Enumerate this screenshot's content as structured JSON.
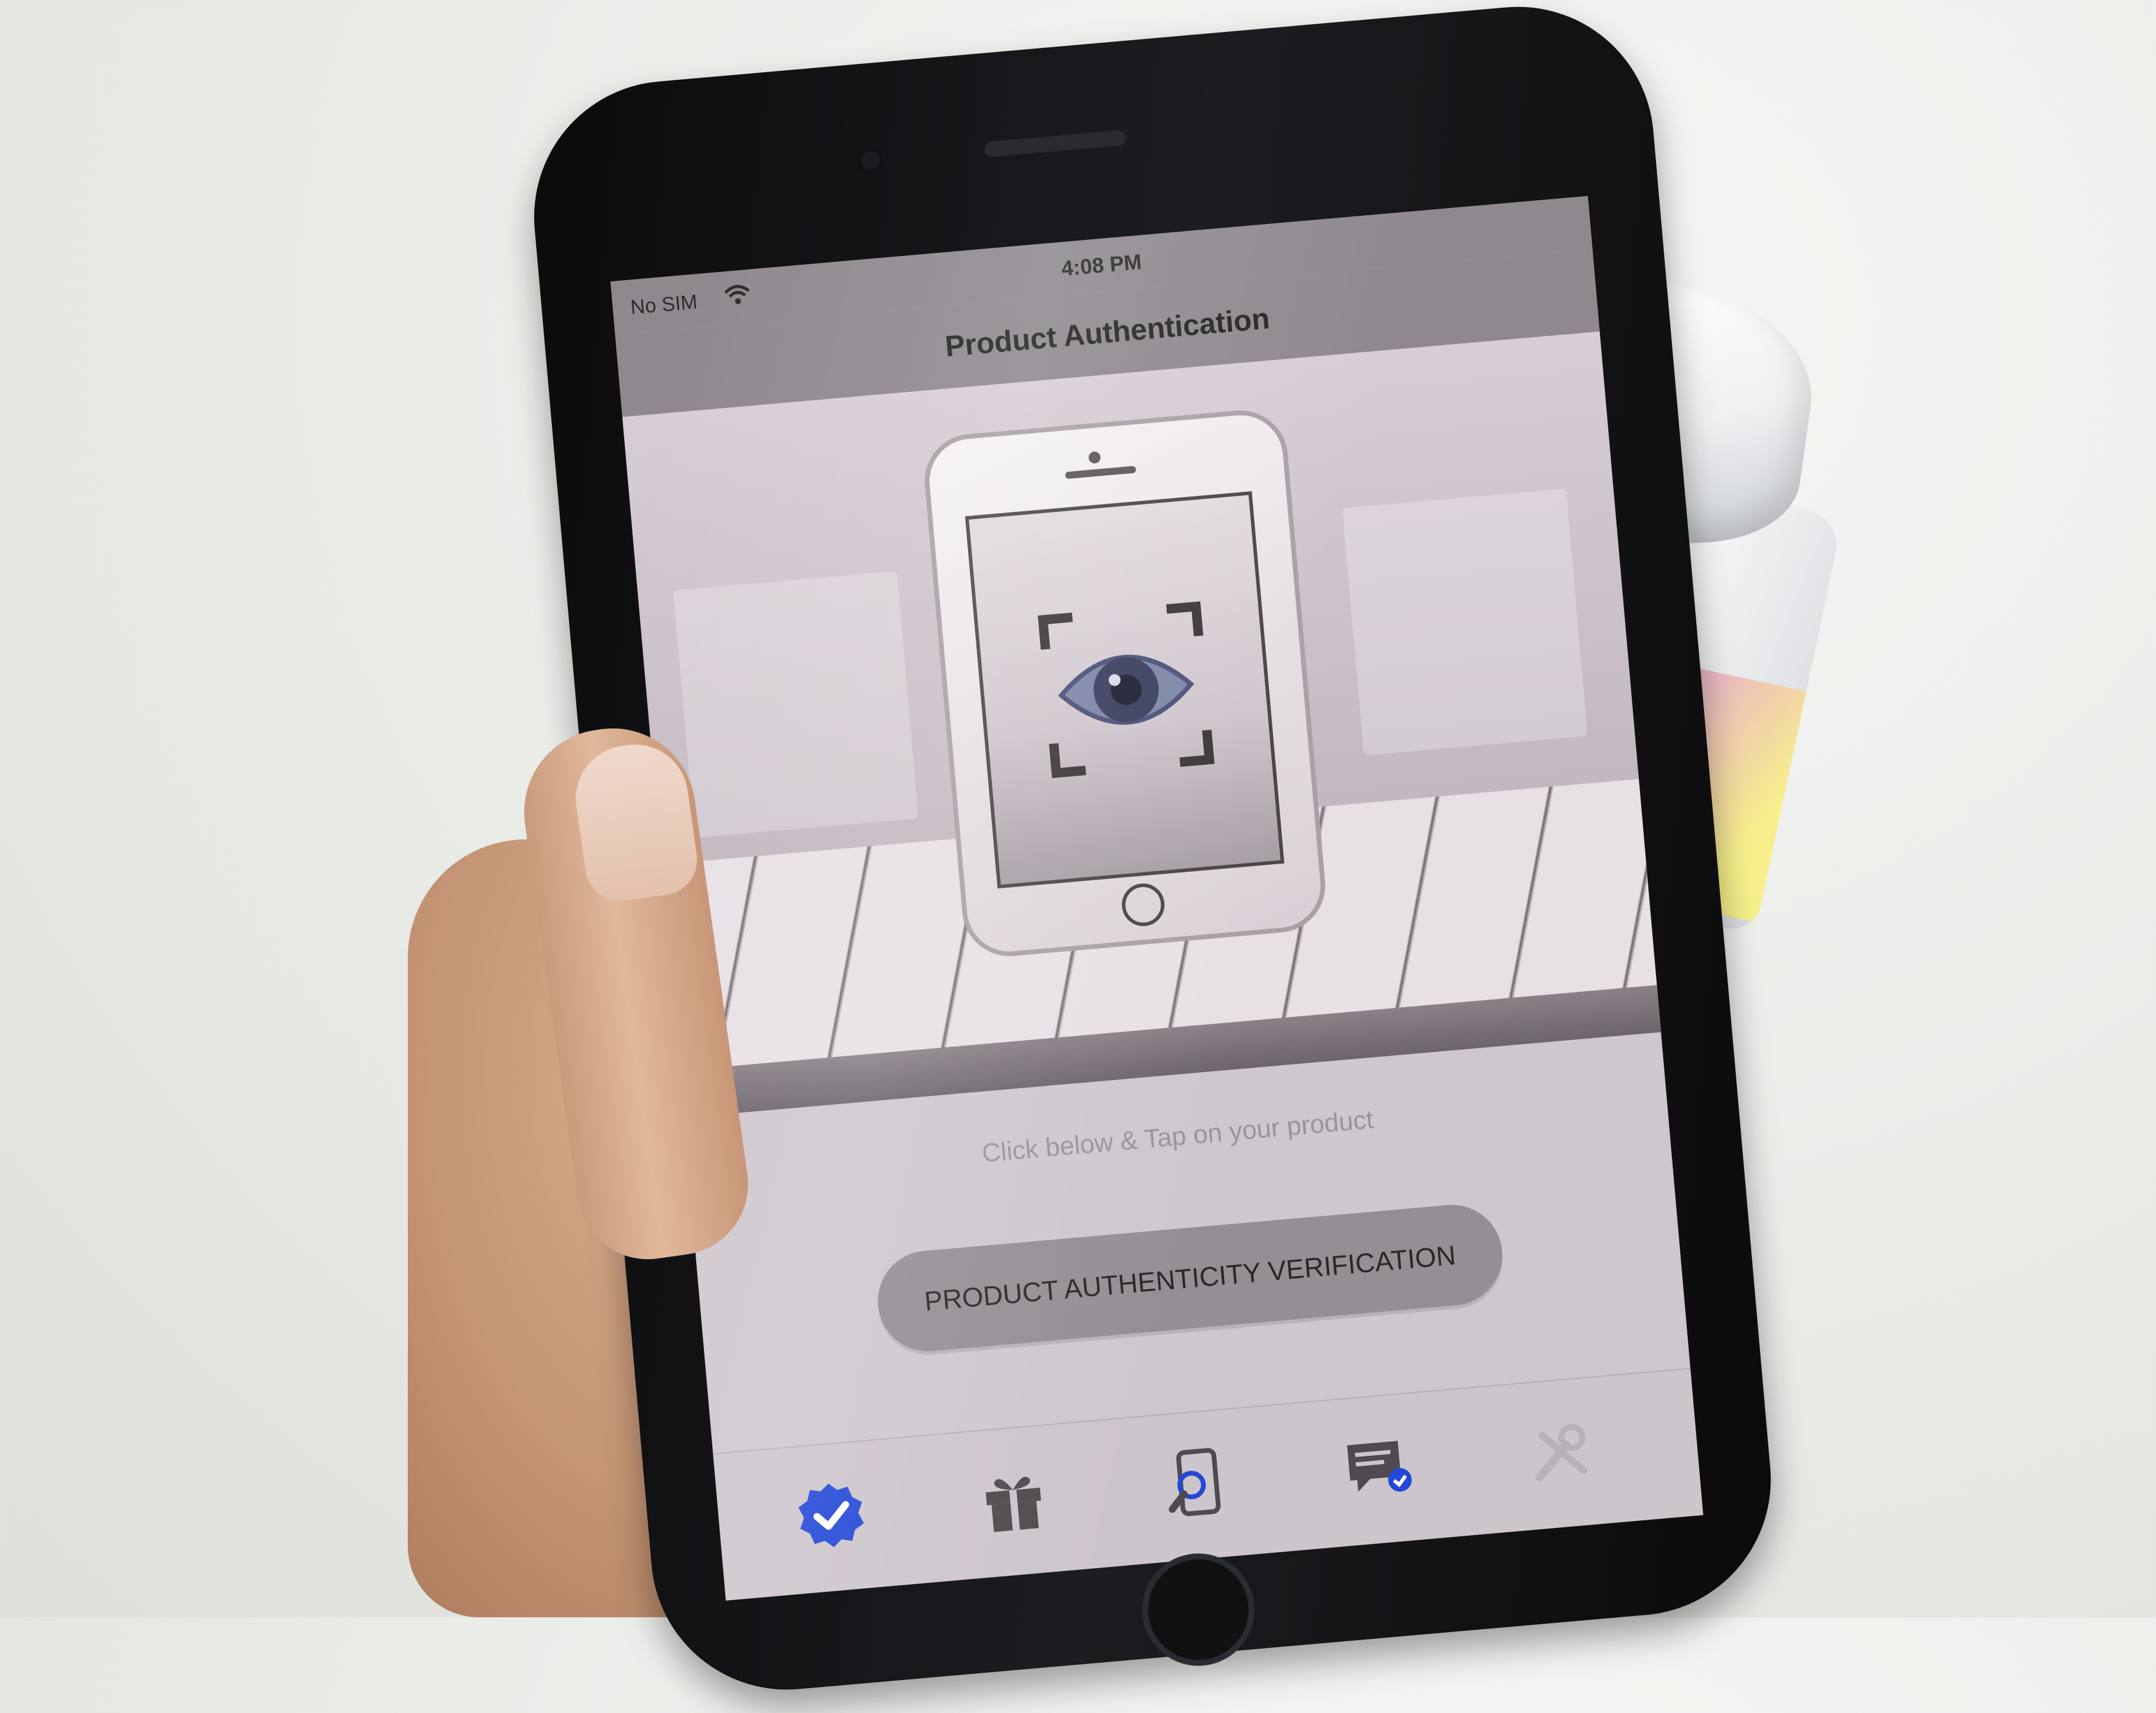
{
  "status_bar": {
    "carrier": "No SIM",
    "time": "4:08 PM"
  },
  "nav": {
    "title": "Product Authentication"
  },
  "main": {
    "instruction": "Click below & Tap on your product",
    "verify_button": "PRODUCT AUTHENTICITY VERIFICATION"
  },
  "tab_bar": {
    "items": [
      {
        "icon": "verified-badge-icon",
        "selected": true
      },
      {
        "icon": "gift-icon",
        "selected": false
      },
      {
        "icon": "phone-search-icon",
        "selected": false
      },
      {
        "icon": "chat-check-icon",
        "selected": false
      },
      {
        "icon": "tools-icon",
        "selected": false
      }
    ]
  },
  "colors": {
    "accent_blue": "#2348d6",
    "tab_icon": "#4f4a4f",
    "nav_background": "#8f898f",
    "button_background": "#958e95"
  }
}
